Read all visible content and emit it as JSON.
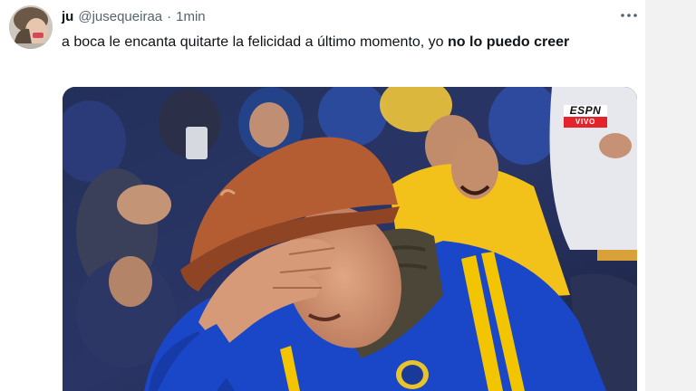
{
  "tweet": {
    "display_name": "ju",
    "handle": "@jusequeiraa",
    "separator": "·",
    "time": "1min",
    "text_part1": "a boca le encanta quitarte la felicidad a último momento, yo ",
    "text_bold": "no lo puedo creer",
    "more_icon": "more-horizontal-icon"
  },
  "media": {
    "badge_top": "ESPN",
    "badge_bottom": "VIVO"
  },
  "colors": {
    "accent_red": "#e5232a",
    "jersey_blue": "#1a47c8",
    "jersey_gold": "#f3c400",
    "cap_brown": "#b45c32"
  }
}
